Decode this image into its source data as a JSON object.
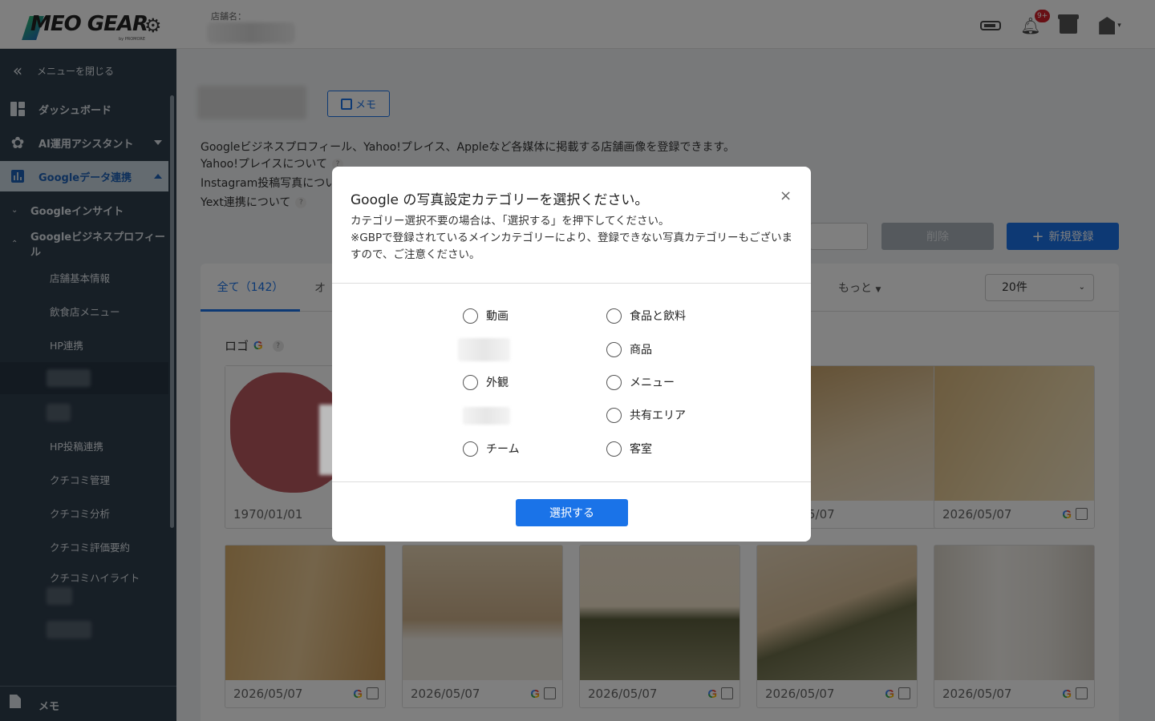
{
  "header": {
    "logo": "MEO GEAR",
    "logo_sub": "by PROMORE",
    "store_label": "店舗名：",
    "notification_badge": "9+"
  },
  "sidebar": {
    "close_menu": "メニューを閉じる",
    "dashboard": "ダッシュボード",
    "ai_assistant": "AI運用アシスタント",
    "google_data": "Googleデータ連携",
    "google_insight": "Googleインサイト",
    "google_business_profile": "Googleビジネスプロフィール",
    "leaves": [
      "店舗基本情報",
      "飲食店メニュー",
      "HP連携",
      "HP投稿連携",
      "クチコミ管理",
      "クチコミ分析",
      "クチコミ評価要約",
      "クチコミハイライト"
    ],
    "memo": "メモ"
  },
  "main": {
    "memo_button": "メモ",
    "description": "Googleビジネスプロフィール、Yahoo!プレイス、Appleなど各媒体に掲載する店舗画像を登録できます。",
    "links": [
      "Yahoo!プレイスについて",
      "Instagram投稿写真につい",
      "Yext連携について"
    ],
    "delete_button": "削除",
    "new_button": "新規登録",
    "tab_all": "全て（142）",
    "tab_other": "オ",
    "tab_more": "もっと",
    "per_page": "20件",
    "logo_section": "ロゴ",
    "cards": [
      {
        "date": "1970/01/01"
      },
      {
        "date": "5/07"
      },
      {
        "date": "2026/05/07"
      },
      {
        "date": "2026/05/07"
      },
      {
        "date": "2026/05/07"
      },
      {
        "date": "2026/05/07"
      },
      {
        "date": "2026/05/07"
      },
      {
        "date": "2026/05/07"
      }
    ]
  },
  "modal": {
    "title": "Google の写真設定カテゴリーを選択ください。",
    "note1": "カテゴリー選択不要の場合は、「選択する」を押下してください。",
    "note2": "※GBPで登録されているメインカテゴリーにより、登録できない写真カテゴリーもございますので、ご注意ください。",
    "options_left": [
      "動画",
      "外観",
      "チーム"
    ],
    "options_right": [
      "食品と飲料",
      "商品",
      "メニュー",
      "共有エリア",
      "客室"
    ],
    "select_button": "選択する"
  },
  "colors": {
    "accent": "#1a73e8",
    "sidebar_bg": "#2f3e4d",
    "badge": "#d0202b"
  }
}
